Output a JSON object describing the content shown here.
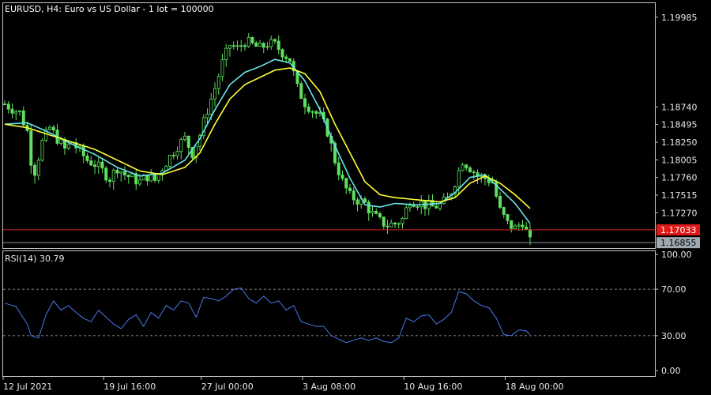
{
  "header": {
    "title": "EURUSD, H4:  Euro vs US Dollar - 1 lot = 100000"
  },
  "colors": {
    "background": "#000000",
    "frame": "#c8c8c8",
    "candle_up": "#5ee05e",
    "candle_down": "#5ee05e",
    "ma_fast": "#ffff33",
    "ma_slow": "#66e6e6",
    "rsi_line": "#4a78e8",
    "level_line": "#cc2222",
    "level_badge": "#e01818",
    "bid_badge": "#a0a8b0"
  },
  "chart_data": [
    {
      "type": "candlestick",
      "symbol": "EURUSD",
      "timeframe": "H4",
      "ylim": [
        1.1678,
        1.2018
      ],
      "y_ticks": [
        "1.19985",
        "1.18740",
        "1.18495",
        "1.18250",
        "1.18005",
        "1.17760",
        "1.17515",
        "1.17270"
      ],
      "x_ticks": [
        "12 Jul 2021",
        "19 Jul 16:00",
        "27 Jul 00:00",
        "3 Aug 08:00",
        "10 Aug 16:00",
        "18 Aug 00:00"
      ],
      "price_lines": [
        {
          "label": "1.17033",
          "value": 1.17033,
          "kind": "level"
        },
        {
          "label": "1.16855",
          "value": 1.16855,
          "kind": "bid"
        }
      ],
      "close_path": [
        [
          0,
          1.1878
        ],
        [
          2,
          1.1872
        ],
        [
          4,
          1.1866
        ],
        [
          6,
          1.184
        ],
        [
          7,
          1.18
        ],
        [
          8,
          1.1785
        ],
        [
          10,
          1.1825
        ],
        [
          12,
          1.1845
        ],
        [
          14,
          1.183
        ],
        [
          16,
          1.1815
        ],
        [
          18,
          1.1825
        ],
        [
          20,
          1.1812
        ],
        [
          22,
          1.18
        ],
        [
          24,
          1.1795
        ],
        [
          26,
          1.1785
        ],
        [
          28,
          1.1775
        ],
        [
          30,
          1.179
        ],
        [
          32,
          1.178
        ],
        [
          34,
          1.1775
        ],
        [
          36,
          1.177
        ],
        [
          38,
          1.1778
        ],
        [
          40,
          1.1772
        ],
        [
          42,
          1.179
        ],
        [
          44,
          1.1805
        ],
        [
          46,
          1.182
        ],
        [
          48,
          1.183
        ],
        [
          50,
          1.181
        ],
        [
          52,
          1.1835
        ],
        [
          54,
          1.187
        ],
        [
          56,
          1.19
        ],
        [
          58,
          1.1935
        ],
        [
          60,
          1.196
        ],
        [
          62,
          1.1955
        ],
        [
          64,
          1.1965
        ],
        [
          66,
          1.196
        ],
        [
          68,
          1.1955
        ],
        [
          70,
          1.1962
        ],
        [
          72,
          1.196
        ],
        [
          74,
          1.195
        ],
        [
          76,
          1.194
        ],
        [
          78,
          1.19
        ],
        [
          80,
          1.188
        ],
        [
          82,
          1.187
        ],
        [
          84,
          1.186
        ],
        [
          86,
          1.184
        ],
        [
          88,
          1.18
        ],
        [
          90,
          1.177
        ],
        [
          92,
          1.175
        ],
        [
          94,
          1.1745
        ],
        [
          96,
          1.174
        ],
        [
          98,
          1.1725
        ],
        [
          100,
          1.1715
        ],
        [
          102,
          1.171
        ],
        [
          104,
          1.1712
        ],
        [
          106,
          1.1718
        ],
        [
          108,
          1.1745
        ],
        [
          110,
          1.1742
        ],
        [
          112,
          1.1738
        ],
        [
          114,
          1.1735
        ],
        [
          116,
          1.1738
        ],
        [
          118,
          1.1745
        ],
        [
          120,
          1.177
        ],
        [
          122,
          1.18
        ],
        [
          124,
          1.179
        ],
        [
          126,
          1.1778
        ],
        [
          128,
          1.1775
        ],
        [
          130,
          1.177
        ],
        [
          132,
          1.173
        ],
        [
          134,
          1.1712
        ],
        [
          136,
          1.1705
        ],
        [
          138,
          1.1715
        ],
        [
          140,
          1.1686
        ]
      ],
      "series": [
        {
          "values": [
            [
              0,
              1.185
            ],
            [
              6,
              1.1852
            ],
            [
              12,
              1.1838
            ],
            [
              18,
              1.1822
            ],
            [
              24,
              1.1808
            ],
            [
              30,
              1.179
            ],
            [
              36,
              1.1778
            ],
            [
              42,
              1.1782
            ],
            [
              48,
              1.18
            ],
            [
              52,
              1.183
            ],
            [
              56,
              1.187
            ],
            [
              60,
              1.1905
            ],
            [
              64,
              1.1922
            ],
            [
              68,
              1.193
            ],
            [
              72,
              1.194
            ],
            [
              76,
              1.1935
            ],
            [
              80,
              1.191
            ],
            [
              84,
              1.187
            ],
            [
              88,
              1.182
            ],
            [
              92,
              1.1775
            ],
            [
              96,
              1.1738
            ],
            [
              100,
              1.1735
            ],
            [
              104,
              1.174
            ],
            [
              110,
              1.1738
            ],
            [
              116,
              1.174
            ],
            [
              120,
              1.1755
            ],
            [
              124,
              1.1776
            ],
            [
              128,
              1.178
            ],
            [
              132,
              1.176
            ],
            [
              136,
              1.174
            ],
            [
              140,
              1.1712
            ]
          ]
        },
        {
          "values": [
            [
              0,
              1.185
            ],
            [
              6,
              1.1845
            ],
            [
              12,
              1.1835
            ],
            [
              18,
              1.1825
            ],
            [
              24,
              1.1815
            ],
            [
              30,
              1.18
            ],
            [
              36,
              1.1785
            ],
            [
              42,
              1.178
            ],
            [
              48,
              1.179
            ],
            [
              52,
              1.181
            ],
            [
              56,
              1.185
            ],
            [
              60,
              1.1885
            ],
            [
              64,
              1.1905
            ],
            [
              68,
              1.1915
            ],
            [
              72,
              1.1925
            ],
            [
              76,
              1.1928
            ],
            [
              80,
              1.192
            ],
            [
              84,
              1.1895
            ],
            [
              88,
              1.185
            ],
            [
              92,
              1.181
            ],
            [
              96,
              1.177
            ],
            [
              100,
              1.1752
            ],
            [
              104,
              1.1748
            ],
            [
              110,
              1.1745
            ],
            [
              116,
              1.1742
            ],
            [
              120,
              1.1748
            ],
            [
              124,
              1.1768
            ],
            [
              128,
              1.1778
            ],
            [
              132,
              1.1768
            ],
            [
              136,
              1.1752
            ],
            [
              140,
              1.1733
            ]
          ]
        }
      ]
    },
    {
      "type": "line",
      "indicator_label": "RSI(14) 30.79",
      "ylim": [
        0,
        100
      ],
      "y_ticks": [
        "100.00",
        "70.00",
        "30.00",
        "0.00"
      ],
      "levels": [
        70,
        30
      ],
      "series": [
        {
          "values": [
            [
              0,
              58
            ],
            [
              3,
              55
            ],
            [
              6,
              40
            ],
            [
              7,
              30
            ],
            [
              9,
              28
            ],
            [
              11,
              48
            ],
            [
              13,
              60
            ],
            [
              15,
              52
            ],
            [
              17,
              56
            ],
            [
              19,
              50
            ],
            [
              21,
              45
            ],
            [
              23,
              42
            ],
            [
              25,
              52
            ],
            [
              27,
              46
            ],
            [
              29,
              40
            ],
            [
              31,
              36
            ],
            [
              33,
              44
            ],
            [
              35,
              48
            ],
            [
              37,
              38
            ],
            [
              39,
              50
            ],
            [
              41,
              45
            ],
            [
              43,
              56
            ],
            [
              45,
              52
            ],
            [
              47,
              60
            ],
            [
              49,
              58
            ],
            [
              51,
              46
            ],
            [
              53,
              63
            ],
            [
              55,
              62
            ],
            [
              57,
              60
            ],
            [
              59,
              64
            ],
            [
              61,
              70
            ],
            [
              63,
              71
            ],
            [
              65,
              62
            ],
            [
              67,
              58
            ],
            [
              69,
              64
            ],
            [
              71,
              58
            ],
            [
              73,
              60
            ],
            [
              75,
              52
            ],
            [
              77,
              56
            ],
            [
              79,
              42
            ],
            [
              81,
              40
            ],
            [
              83,
              38
            ],
            [
              85,
              38
            ],
            [
              87,
              30
            ],
            [
              89,
              27
            ],
            [
              91,
              24
            ],
            [
              93,
              26
            ],
            [
              95,
              28
            ],
            [
              97,
              26
            ],
            [
              99,
              28
            ],
            [
              101,
              25
            ],
            [
              103,
              24
            ],
            [
              105,
              28
            ],
            [
              107,
              45
            ],
            [
              109,
              42
            ],
            [
              111,
              47
            ],
            [
              113,
              48
            ],
            [
              115,
              40
            ],
            [
              117,
              44
            ],
            [
              119,
              50
            ],
            [
              121,
              68
            ],
            [
              123,
              66
            ],
            [
              125,
              60
            ],
            [
              127,
              56
            ],
            [
              129,
              54
            ],
            [
              131,
              45
            ],
            [
              133,
              31
            ],
            [
              135,
              30
            ],
            [
              137,
              35
            ],
            [
              139,
              34
            ],
            [
              140,
              30.79
            ]
          ]
        }
      ]
    }
  ]
}
